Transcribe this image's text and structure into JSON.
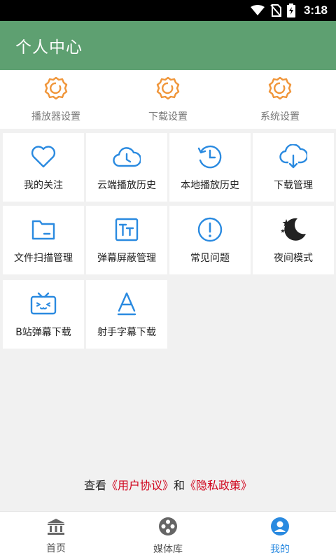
{
  "status_bar": {
    "time": "3:18",
    "icons": [
      "wifi-icon",
      "no-sim-icon",
      "battery-charging-icon"
    ]
  },
  "header": {
    "title": "个人中心"
  },
  "settings": [
    {
      "label": "播放器设置",
      "icon": "gear-icon"
    },
    {
      "label": "下载设置",
      "icon": "gear-icon"
    },
    {
      "label": "系统设置",
      "icon": "gear-icon"
    }
  ],
  "grid": [
    {
      "label": "我的关注",
      "icon": "heart-icon"
    },
    {
      "label": "云端播放历史",
      "icon": "cloud-clock-icon"
    },
    {
      "label": "本地播放历史",
      "icon": "history-clock-icon"
    },
    {
      "label": "下载管理",
      "icon": "cloud-download-icon"
    },
    {
      "label": "文件扫描管理",
      "icon": "folder-icon"
    },
    {
      "label": "弹幕屏蔽管理",
      "icon": "text-block-icon"
    },
    {
      "label": "常见问题",
      "icon": "exclamation-icon"
    },
    {
      "label": "夜间模式",
      "icon": "moon-stars-icon"
    },
    {
      "label": "B站弹幕下载",
      "icon": "bilibili-tv-icon"
    },
    {
      "label": "射手字幕下载",
      "icon": "letter-a-icon"
    }
  ],
  "agreement": {
    "prefix": "查看",
    "user_agreement": "《用户协议》",
    "conjunction": "和",
    "privacy_policy": "《隐私政策》"
  },
  "bottom_nav": [
    {
      "label": "首页",
      "icon": "bank-icon",
      "active": false
    },
    {
      "label": "媒体库",
      "icon": "film-reel-icon",
      "active": false
    },
    {
      "label": "我的",
      "icon": "user-icon",
      "active": true
    }
  ],
  "colors": {
    "header_bg": "#5ea071",
    "accent_orange": "#f0963a",
    "accent_blue": "#2a8ae0",
    "link_red": "#d0021b"
  }
}
